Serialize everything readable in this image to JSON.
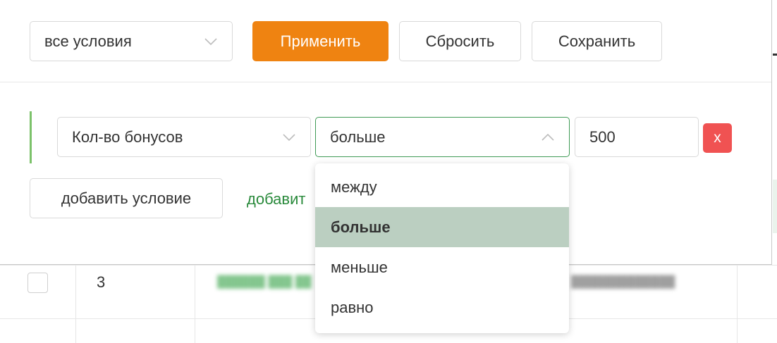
{
  "toolbar": {
    "conditions_select": "все условия",
    "apply_label": "Применить",
    "reset_label": "Сбросить",
    "save_label": "Сохранить"
  },
  "condition": {
    "field_select": "Кол-во бонусов",
    "operator_select": "больше",
    "value": "500",
    "remove_label": "x"
  },
  "actions": {
    "add_condition_label": "добавить условие",
    "add_link_label": "добавит"
  },
  "operator_options": [
    {
      "label": "между",
      "selected": false
    },
    {
      "label": "больше",
      "selected": true
    },
    {
      "label": "меньше",
      "selected": false
    },
    {
      "label": "равно",
      "selected": false
    }
  ],
  "table": {
    "row_number": "3"
  },
  "colors": {
    "primary": "#ef8311",
    "remove": "#f05252",
    "focus_border": "#3f9a55",
    "selected_option_bg": "#bbcfc1",
    "link": "#2a8a3c"
  }
}
